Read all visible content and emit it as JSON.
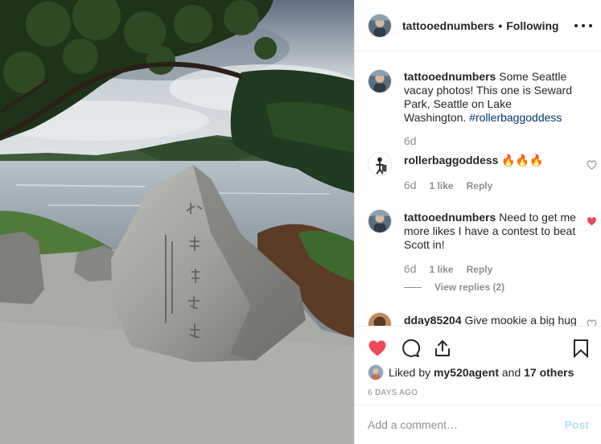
{
  "header": {
    "username": "tattooednumbers",
    "separator": "•",
    "follow_status": "Following"
  },
  "caption": {
    "username": "tattooednumbers",
    "text": "Some Seattle vacay photos! This one is Seward Park, Seattle on Lake Washington.",
    "hashtag": "#rollerbaggoddess",
    "time": "6d"
  },
  "comments": [
    {
      "username": "rollerbaggoddess",
      "text": "🔥🔥🔥",
      "time": "6d",
      "likes": "1 like",
      "reply": "Reply",
      "liked": false
    },
    {
      "username": "tattooednumbers",
      "text": "Need to get me more likes I have a contest to beat Scott in!",
      "time": "6d",
      "likes": "1 like",
      "reply": "Reply",
      "liked": true,
      "view_replies": "View replies (2)"
    },
    {
      "username": "dday85204",
      "text": "Give mookie a big hug",
      "liked": false
    }
  ],
  "likes": {
    "prefix": "Liked by",
    "liker": "my520agent",
    "conjunction": "and",
    "others": "17 others"
  },
  "time_ago": "6 DAYS AGO",
  "add_comment": {
    "placeholder": "Add a comment…",
    "post_label": "Post"
  },
  "colors": {
    "heart_red": "#ed4956",
    "hashtag_blue": "#00376b",
    "post_disabled": "#b2dffc",
    "muted": "#8e8e8e"
  },
  "icons": [
    "more-options-icon",
    "heart-icon",
    "comment-icon",
    "share-icon",
    "bookmark-icon"
  ]
}
